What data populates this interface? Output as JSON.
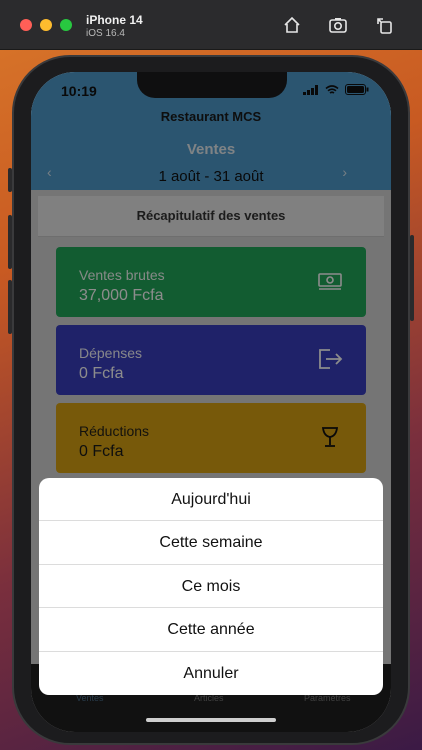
{
  "simulator": {
    "device": "iPhone 14",
    "os": "iOS 16.4",
    "icons": [
      "home-icon",
      "screenshot-icon",
      "rotate-icon"
    ]
  },
  "status_bar": {
    "time": "10:19"
  },
  "header": {
    "app_title": "Restaurant MCS",
    "section_title": "Ventes",
    "date_range": "1 août - 31 août",
    "prev_label": "‹",
    "next_label": "›"
  },
  "summary": {
    "title": "Récapitulatif des ventes"
  },
  "cards": {
    "gross": {
      "label": "Ventes brutes",
      "value": "37,000 Fcfa",
      "icon": "money-icon",
      "color": "#22a85a"
    },
    "expenses": {
      "label": "Dépenses",
      "value": "0 Fcfa",
      "icon": "exit-icon",
      "color": "#3a3fbf"
    },
    "discounts": {
      "label": "Réductions",
      "value": "0 Fcfa",
      "icon": "glass-icon",
      "color": "#d9a313"
    }
  },
  "tabs": {
    "ventes": "Ventes",
    "articles": "Articles",
    "parametres": "Paramètres"
  },
  "action_sheet": {
    "today": "Aujourd'hui",
    "week": "Cette semaine",
    "month": "Ce mois",
    "year": "Cette année",
    "cancel": "Annuler"
  }
}
